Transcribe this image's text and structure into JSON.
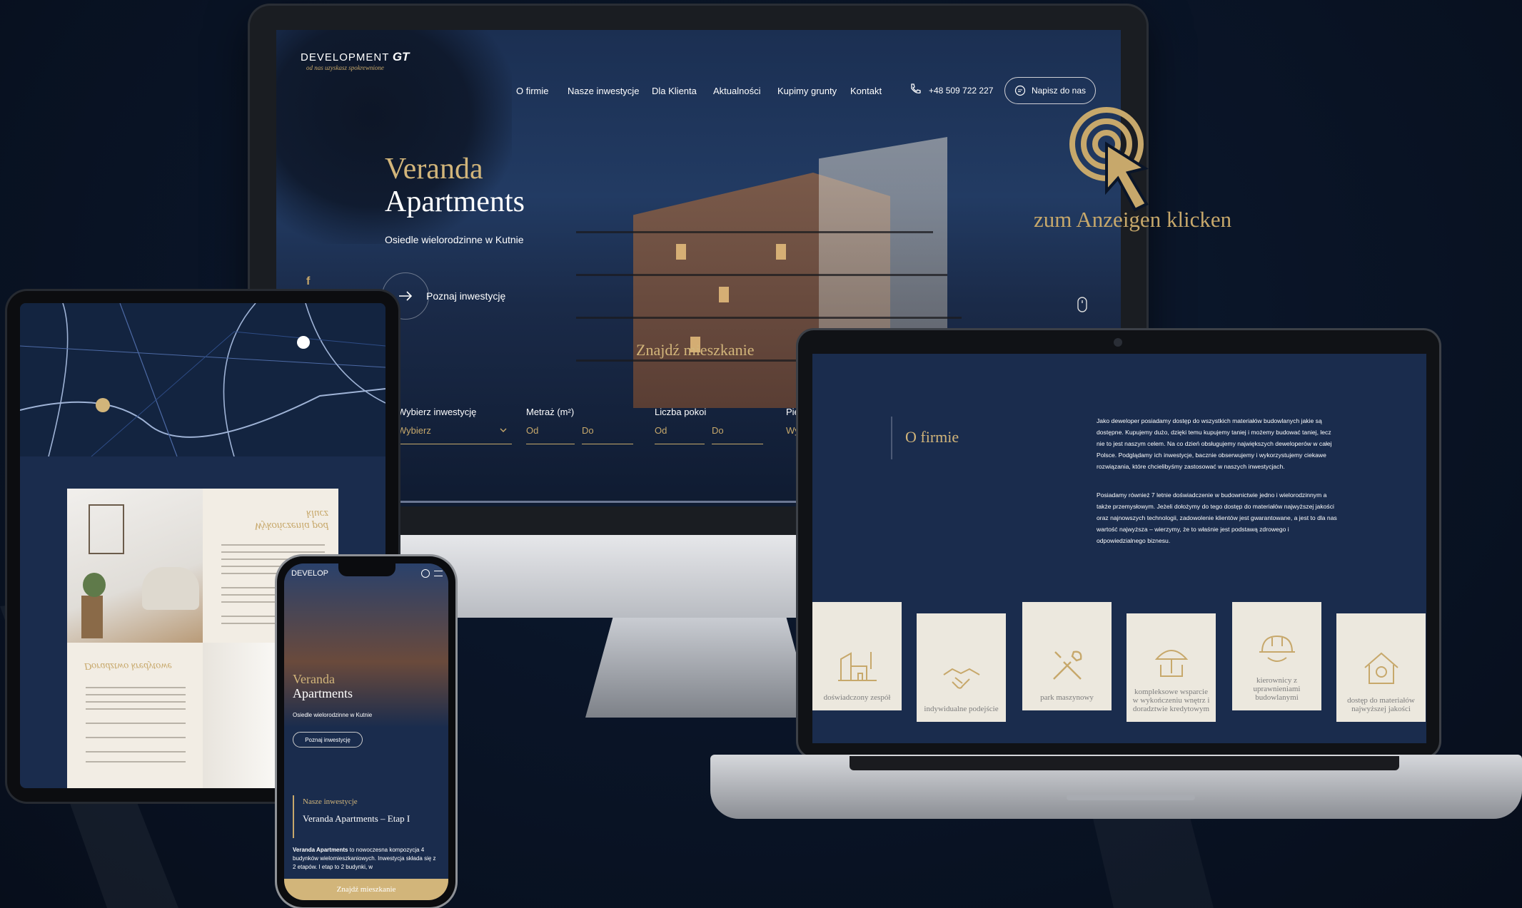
{
  "monitor": {
    "brand": {
      "name": "DEVELOPMENT",
      "mark": "GT",
      "tagline": "od nas uzyskasz spokrewnione"
    },
    "nav": [
      "O firmie",
      "Nasze inwestycje",
      "Dla Klienta",
      "Aktualności",
      "Kupimy grunty",
      "Kontakt"
    ],
    "phone": "+48 509 722 227",
    "contact_button": "Napisz do nas",
    "hero": {
      "title_line1": "Veranda",
      "title_line2": "Apartments",
      "subtitle": "Osiedle wielorodzinne w Kutnie",
      "cta": "Poznaj inwestycję"
    },
    "search": {
      "title": "Znajdź mieszkanie",
      "fields": [
        {
          "label": "Wybierz inwestycję",
          "placeholder": "Wybierz"
        },
        {
          "label": "Metraż (m²)",
          "from": "Od",
          "to": "Do"
        },
        {
          "label": "Liczba pokoi",
          "from": "Od",
          "to": "Do"
        },
        {
          "label": "Pię",
          "placeholder": "Wy"
        }
      ]
    }
  },
  "overlay": {
    "click_hint": "zum Anzeigen klicken"
  },
  "laptop": {
    "section_title": "O firmie",
    "paragraph1": "Jako deweloper posiadamy dostęp do wszystkich materiałów budowlanych jakie są dostępne. Kupujemy dużo, dzięki temu kupujemy taniej i możemy budować taniej, lecz nie to jest naszym celem. Na co dzień obsługujemy największych deweloperów w całej Polsce. Podglądamy ich inwestycje, bacznie obserwujemy i wykorzystujemy ciekawe rozwiązania, które chcielibyśmy zastosować w naszych inwestycjach.",
    "paragraph2": "Posiadamy również 7 letnie doświadczenie w budownictwie jedno i wielorodzinnym a także przemysłowym. Jeżeli dołożymy do tego dostęp do materiałów najwyższej jakości oraz najnowszych technologii, zadowolenie klientów jest gwarantowane, a jest to dla nas wartość najwyższa – wierzymy, że to właśnie jest podstawą zdrowego i odpowiedzialnego biznesu.",
    "features": [
      "doświadczony zespół",
      "indywidualne podejście",
      "park maszynowy",
      "kompleksowe wsparcie w wykończeniu wnętrz i doradztwie kredytowym",
      "kierownicy z uprawnieniami budowlanymi",
      "dostęp do materiałów najwyższej jakości"
    ]
  },
  "tablet": {
    "card1_title": "Wykończenia pod klucz",
    "card2_title": "Doradztwo kredytowe"
  },
  "phone": {
    "brand": "DEVELOP",
    "hero_title_line1": "Veranda",
    "hero_title_line2": "Apartments",
    "hero_subtitle": "Osiedle wielorodzinne w Kutnie",
    "cta": "Poznaj inwestycję",
    "section_label": "Nasze inwestycje",
    "investment_title": "Veranda Apartments – Etap I",
    "investment_lead": "Veranda Apartments",
    "investment_text": "to nowoczesna kompozycja 4 budynków wielomieszkaniowych. Inwestycja składa się z 2 etapów. I etap to 2 budynki, w",
    "bottom_button": "Znajdź mieszkanie"
  },
  "colors": {
    "navy": "#1a2c4d",
    "gold": "#d2b57a",
    "cream": "#ece8de"
  }
}
